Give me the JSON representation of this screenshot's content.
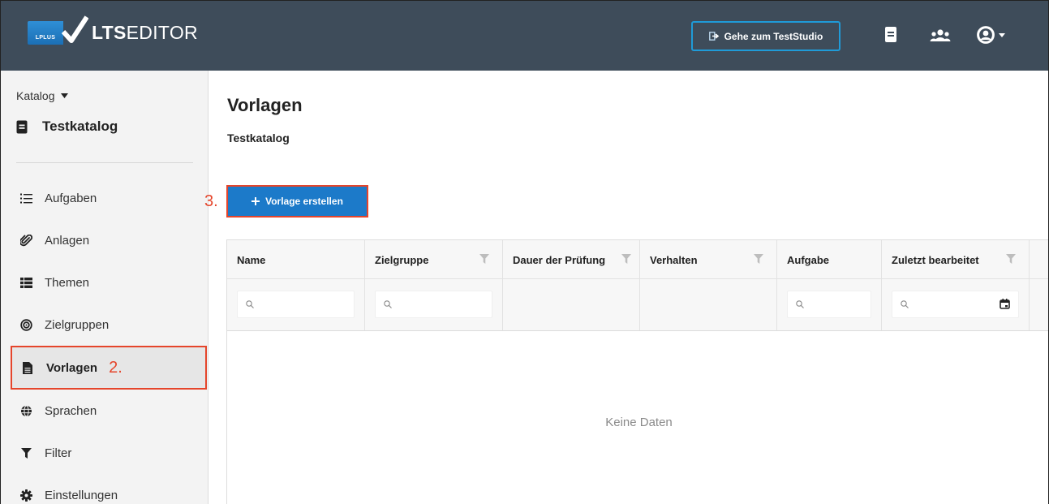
{
  "header": {
    "logo_badge": "LPLUS",
    "logo_bold": "LTS",
    "logo_rest": "EDITOR",
    "studio_button": "Gehe zum TestStudio"
  },
  "sidebar": {
    "catalog_dropdown": "Katalog",
    "catalog_title": "Testkatalog",
    "items": [
      {
        "label": "Aufgaben",
        "icon": "list-icon"
      },
      {
        "label": "Anlagen",
        "icon": "paperclip-icon"
      },
      {
        "label": "Themen",
        "icon": "table-list-icon"
      },
      {
        "label": "Zielgruppen",
        "icon": "target-icon"
      },
      {
        "label": "Vorlagen",
        "icon": "file-icon",
        "active": true,
        "step": "2."
      },
      {
        "label": "Sprachen",
        "icon": "globe-icon"
      },
      {
        "label": "Filter",
        "icon": "filter-icon"
      },
      {
        "label": "Einstellungen",
        "icon": "gear-icon"
      }
    ]
  },
  "main": {
    "title": "Vorlagen",
    "subtitle": "Testkatalog",
    "step3": "3.",
    "create_button": "Vorlage erstellen",
    "table": {
      "columns": [
        {
          "label": "Name",
          "filter": false,
          "search": true
        },
        {
          "label": "Zielgruppe",
          "filter": true,
          "search": true
        },
        {
          "label": "Dauer der Prüfung",
          "filter": true,
          "search": false
        },
        {
          "label": "Verhalten",
          "filter": true,
          "search": false
        },
        {
          "label": "Aufgabe",
          "filter": false,
          "search": true
        },
        {
          "label": "Zuletzt bearbeitet",
          "filter": true,
          "search": true,
          "calendar": true
        }
      ],
      "empty_text": "Keine Daten"
    }
  },
  "colors": {
    "header_bg": "#3e4c5a",
    "accent_blue": "#1c7ac9",
    "highlight_red": "#e5452b"
  }
}
